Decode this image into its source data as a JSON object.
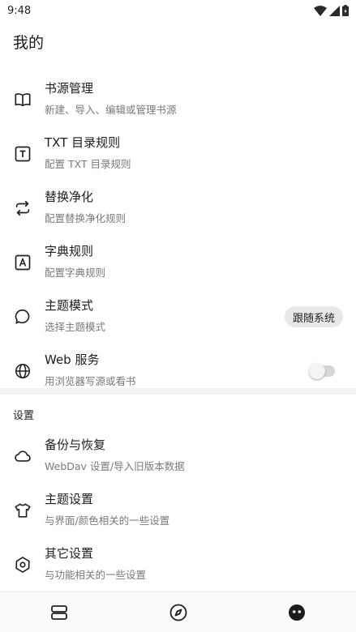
{
  "status_bar": {
    "time": "9:48"
  },
  "page": {
    "title": "我的"
  },
  "menu_items": [
    {
      "title": "书源管理",
      "subtitle": "新建、导入、编辑或管理书源",
      "icon": "book-icon"
    },
    {
      "title": "TXT 目录规则",
      "subtitle": "配置 TXT 目录规则",
      "icon": "t-box-icon"
    },
    {
      "title": "替换净化",
      "subtitle": "配置替换净化规则",
      "icon": "swap-icon"
    },
    {
      "title": "字典规则",
      "subtitle": "配置字典规则",
      "icon": "a-box-icon"
    },
    {
      "title": "主题模式",
      "subtitle": "选择主题模式",
      "icon": "speech-bubble-icon",
      "value": "跟随系统"
    },
    {
      "title": "Web 服务",
      "subtitle": "用浏览器写源或看书",
      "icon": "globe-icon",
      "toggle": false
    }
  ],
  "settings_section": {
    "header": "设置",
    "items": [
      {
        "title": "备份与恢复",
        "subtitle": "WebDav 设置/导入旧版本数据",
        "icon": "cloud-icon"
      },
      {
        "title": "主题设置",
        "subtitle": "与界面/颜色相关的一些设置",
        "icon": "shirt-icon"
      },
      {
        "title": "其它设置",
        "subtitle": "与功能相关的一些设置",
        "icon": "settings-hexagon-icon"
      }
    ]
  },
  "bottom_nav": [
    {
      "icon": "bookshelf-icon"
    },
    {
      "icon": "compass-icon"
    },
    {
      "icon": "my-face-icon",
      "active": true
    }
  ]
}
